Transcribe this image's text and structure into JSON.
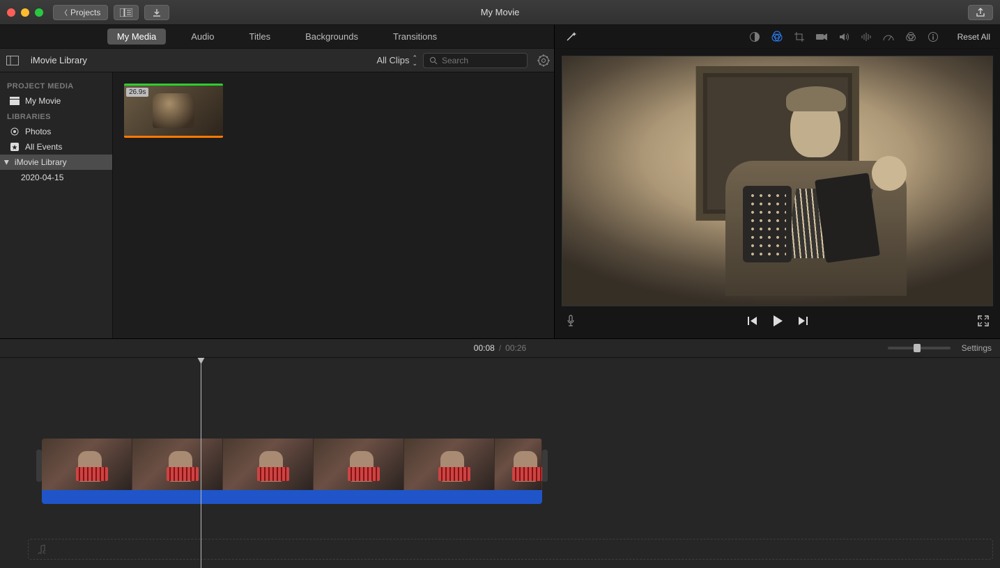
{
  "window": {
    "title": "My Movie"
  },
  "toolbar": {
    "projects": "Projects",
    "share_aria": "Share"
  },
  "tabs": [
    "My Media",
    "Audio",
    "Titles",
    "Backgrounds",
    "Transitions"
  ],
  "tabs_active": 0,
  "browser": {
    "library_label": "iMovie Library",
    "filter": "All Clips",
    "search_placeholder": "Search"
  },
  "sidebar": {
    "heading_project": "PROJECT MEDIA",
    "project_item": "My Movie",
    "heading_libs": "LIBRARIES",
    "photos": "Photos",
    "all_events": "All Events",
    "library": "iMovie Library",
    "event": "2020-04-15"
  },
  "clip": {
    "duration_badge": "26.9s"
  },
  "viewer": {
    "reset_all": "Reset All",
    "icons": [
      "auto-enhance",
      "color-balance",
      "color-correction",
      "crop",
      "stabilization",
      "volume",
      "noise-reduction",
      "speed",
      "clip-filter",
      "info"
    ],
    "active_icon": 1
  },
  "playback": {
    "mic": "Voiceover",
    "prev": "Previous",
    "play": "Play",
    "next": "Next",
    "fullscreen": "Fullscreen"
  },
  "timeline": {
    "current": "00:08",
    "duration": "00:26",
    "settings": "Settings"
  }
}
